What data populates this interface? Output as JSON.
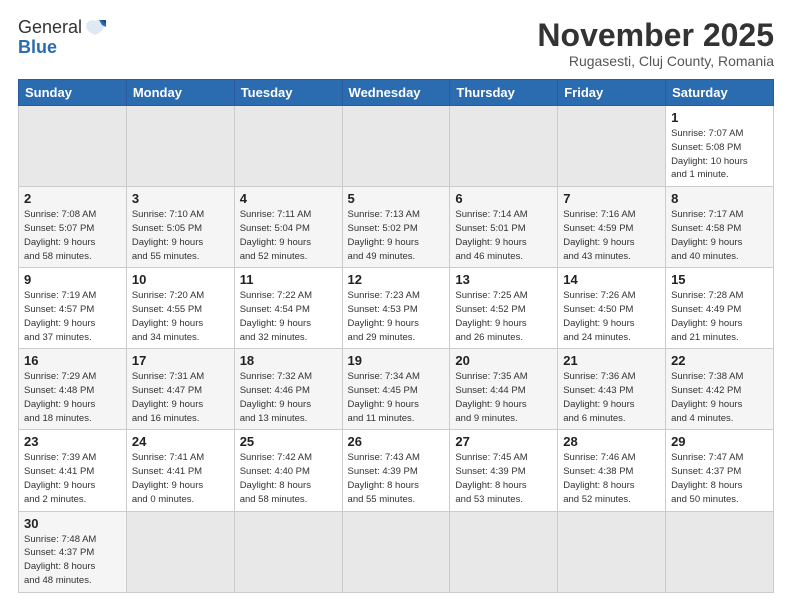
{
  "header": {
    "logo_general": "General",
    "logo_blue": "Blue",
    "month_title": "November 2025",
    "location": "Rugasesti, Cluj County, Romania"
  },
  "weekdays": [
    "Sunday",
    "Monday",
    "Tuesday",
    "Wednesday",
    "Thursday",
    "Friday",
    "Saturday"
  ],
  "weeks": [
    [
      {
        "day": "",
        "info": ""
      },
      {
        "day": "",
        "info": ""
      },
      {
        "day": "",
        "info": ""
      },
      {
        "day": "",
        "info": ""
      },
      {
        "day": "",
        "info": ""
      },
      {
        "day": "",
        "info": ""
      },
      {
        "day": "1",
        "info": "Sunrise: 7:07 AM\nSunset: 5:08 PM\nDaylight: 10 hours\nand 1 minute."
      }
    ],
    [
      {
        "day": "2",
        "info": "Sunrise: 7:08 AM\nSunset: 5:07 PM\nDaylight: 9 hours\nand 58 minutes."
      },
      {
        "day": "3",
        "info": "Sunrise: 7:10 AM\nSunset: 5:05 PM\nDaylight: 9 hours\nand 55 minutes."
      },
      {
        "day": "4",
        "info": "Sunrise: 7:11 AM\nSunset: 5:04 PM\nDaylight: 9 hours\nand 52 minutes."
      },
      {
        "day": "5",
        "info": "Sunrise: 7:13 AM\nSunset: 5:02 PM\nDaylight: 9 hours\nand 49 minutes."
      },
      {
        "day": "6",
        "info": "Sunrise: 7:14 AM\nSunset: 5:01 PM\nDaylight: 9 hours\nand 46 minutes."
      },
      {
        "day": "7",
        "info": "Sunrise: 7:16 AM\nSunset: 4:59 PM\nDaylight: 9 hours\nand 43 minutes."
      },
      {
        "day": "8",
        "info": "Sunrise: 7:17 AM\nSunset: 4:58 PM\nDaylight: 9 hours\nand 40 minutes."
      }
    ],
    [
      {
        "day": "9",
        "info": "Sunrise: 7:19 AM\nSunset: 4:57 PM\nDaylight: 9 hours\nand 37 minutes."
      },
      {
        "day": "10",
        "info": "Sunrise: 7:20 AM\nSunset: 4:55 PM\nDaylight: 9 hours\nand 34 minutes."
      },
      {
        "day": "11",
        "info": "Sunrise: 7:22 AM\nSunset: 4:54 PM\nDaylight: 9 hours\nand 32 minutes."
      },
      {
        "day": "12",
        "info": "Sunrise: 7:23 AM\nSunset: 4:53 PM\nDaylight: 9 hours\nand 29 minutes."
      },
      {
        "day": "13",
        "info": "Sunrise: 7:25 AM\nSunset: 4:52 PM\nDaylight: 9 hours\nand 26 minutes."
      },
      {
        "day": "14",
        "info": "Sunrise: 7:26 AM\nSunset: 4:50 PM\nDaylight: 9 hours\nand 24 minutes."
      },
      {
        "day": "15",
        "info": "Sunrise: 7:28 AM\nSunset: 4:49 PM\nDaylight: 9 hours\nand 21 minutes."
      }
    ],
    [
      {
        "day": "16",
        "info": "Sunrise: 7:29 AM\nSunset: 4:48 PM\nDaylight: 9 hours\nand 18 minutes."
      },
      {
        "day": "17",
        "info": "Sunrise: 7:31 AM\nSunset: 4:47 PM\nDaylight: 9 hours\nand 16 minutes."
      },
      {
        "day": "18",
        "info": "Sunrise: 7:32 AM\nSunset: 4:46 PM\nDaylight: 9 hours\nand 13 minutes."
      },
      {
        "day": "19",
        "info": "Sunrise: 7:34 AM\nSunset: 4:45 PM\nDaylight: 9 hours\nand 11 minutes."
      },
      {
        "day": "20",
        "info": "Sunrise: 7:35 AM\nSunset: 4:44 PM\nDaylight: 9 hours\nand 9 minutes."
      },
      {
        "day": "21",
        "info": "Sunrise: 7:36 AM\nSunset: 4:43 PM\nDaylight: 9 hours\nand 6 minutes."
      },
      {
        "day": "22",
        "info": "Sunrise: 7:38 AM\nSunset: 4:42 PM\nDaylight: 9 hours\nand 4 minutes."
      }
    ],
    [
      {
        "day": "23",
        "info": "Sunrise: 7:39 AM\nSunset: 4:41 PM\nDaylight: 9 hours\nand 2 minutes."
      },
      {
        "day": "24",
        "info": "Sunrise: 7:41 AM\nSunset: 4:41 PM\nDaylight: 9 hours\nand 0 minutes."
      },
      {
        "day": "25",
        "info": "Sunrise: 7:42 AM\nSunset: 4:40 PM\nDaylight: 8 hours\nand 58 minutes."
      },
      {
        "day": "26",
        "info": "Sunrise: 7:43 AM\nSunset: 4:39 PM\nDaylight: 8 hours\nand 55 minutes."
      },
      {
        "day": "27",
        "info": "Sunrise: 7:45 AM\nSunset: 4:39 PM\nDaylight: 8 hours\nand 53 minutes."
      },
      {
        "day": "28",
        "info": "Sunrise: 7:46 AM\nSunset: 4:38 PM\nDaylight: 8 hours\nand 52 minutes."
      },
      {
        "day": "29",
        "info": "Sunrise: 7:47 AM\nSunset: 4:37 PM\nDaylight: 8 hours\nand 50 minutes."
      }
    ],
    [
      {
        "day": "30",
        "info": "Sunrise: 7:48 AM\nSunset: 4:37 PM\nDaylight: 8 hours\nand 48 minutes."
      },
      {
        "day": "",
        "info": ""
      },
      {
        "day": "",
        "info": ""
      },
      {
        "day": "",
        "info": ""
      },
      {
        "day": "",
        "info": ""
      },
      {
        "day": "",
        "info": ""
      },
      {
        "day": "",
        "info": ""
      }
    ]
  ]
}
